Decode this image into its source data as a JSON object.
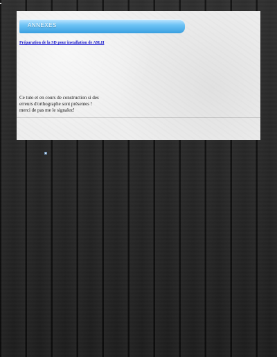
{
  "header": {
    "title": "ANNEXES"
  },
  "links": [
    {
      "label": "Préparation de la SD pour installation de A9LH"
    }
  ],
  "notice": {
    "lines": [
      "Ce tuto et en cours de construction si des",
      "erreurs d'orthographe sont présentes !",
      "merci de pas me le signalez!"
    ]
  },
  "colors": {
    "header_accent": "#3a9fe0",
    "link": "#1111cc",
    "panel_bg": "#eeeeee",
    "page_bg": "#2a2a2a"
  },
  "icons": {
    "corner": "dot-icon",
    "small": "small-image-icon"
  }
}
